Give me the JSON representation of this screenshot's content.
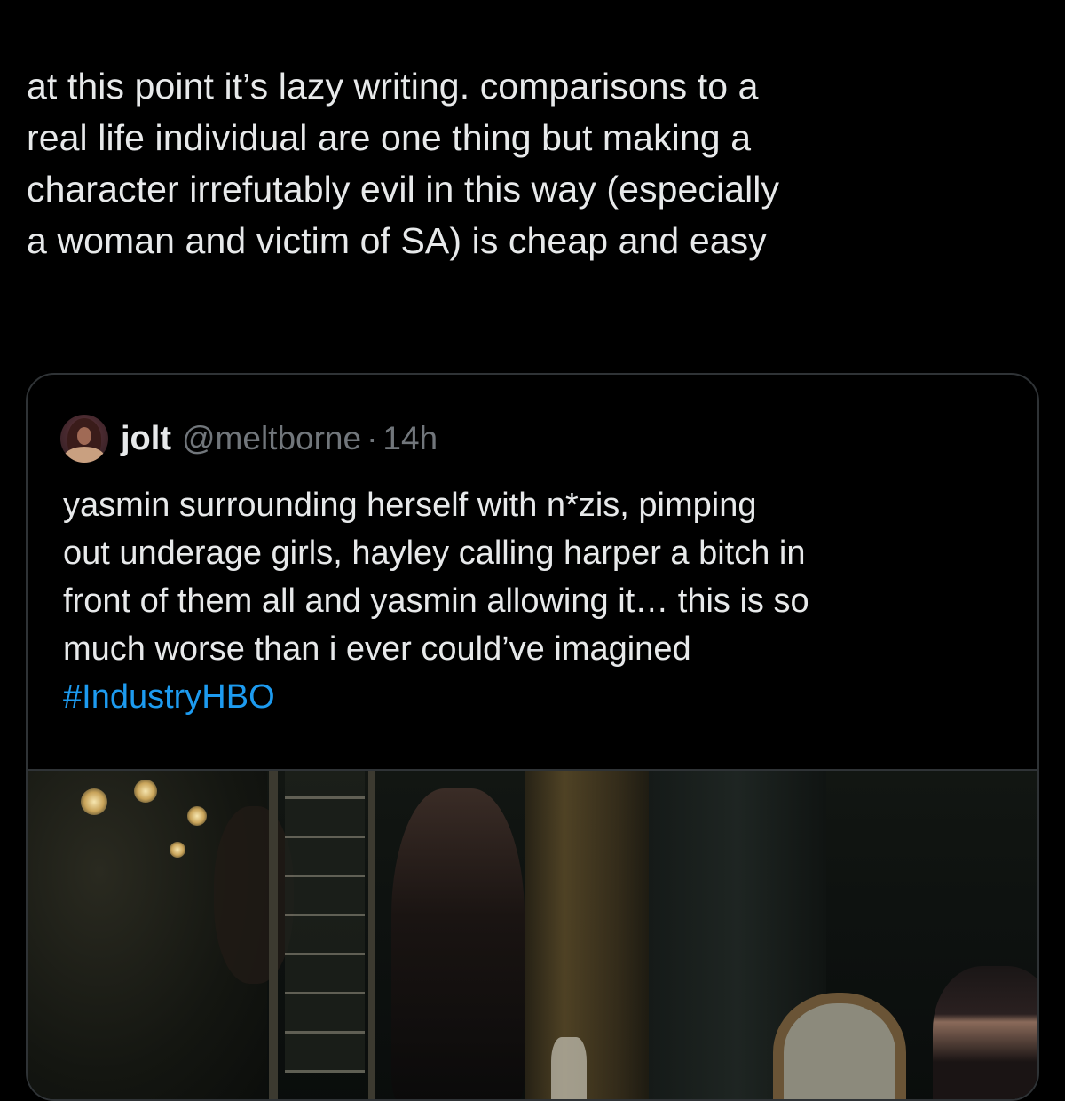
{
  "tweet": {
    "lines": [
      "at this point it’s lazy writing. comparisons to a",
      "real life individual are one thing but making a",
      "character irrefutably evil in this way (especially",
      "a woman and victim of SA) is cheap and easy"
    ]
  },
  "quote": {
    "display_name": "jolt",
    "handle": "@meltborne",
    "separator": "·",
    "time": "14h",
    "lines": [
      "yasmin surrounding herself with n*zis, pimping",
      "out underage girls, hayley calling harper a bitch in",
      "front of them all and yasmin allowing it… this is so",
      "much worse than i ever could’ve imagined"
    ],
    "hashtag": "#IndustryHBO"
  },
  "colors": {
    "background": "#000000",
    "text": "#e7e9ea",
    "secondary_text": "#71767b",
    "link": "#1d9bf0",
    "border": "#2f3336"
  }
}
